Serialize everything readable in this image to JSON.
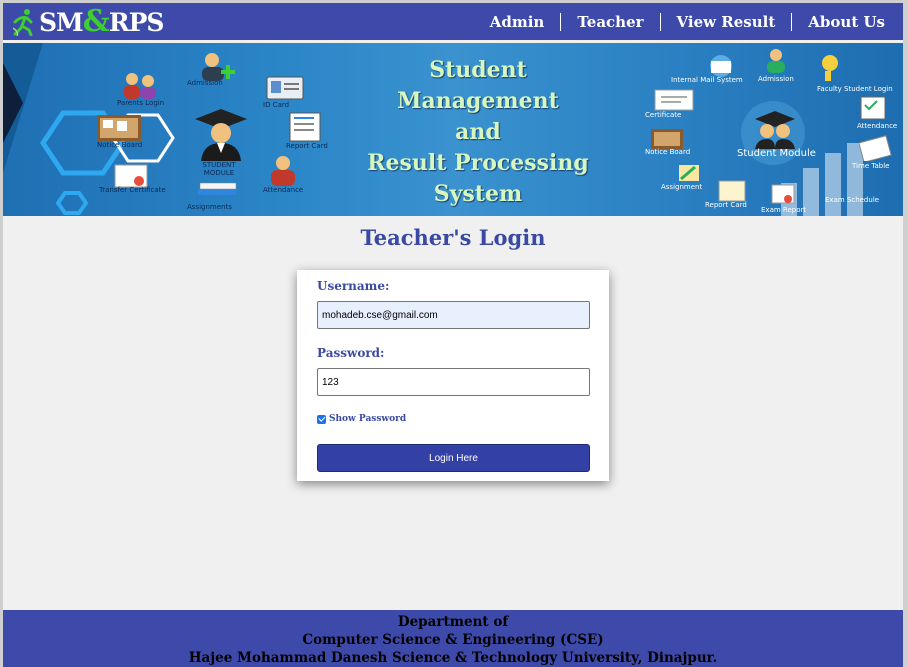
{
  "nav": {
    "logo": {
      "part1": "SM",
      "amp": "&",
      "part2": "RPS"
    },
    "links": [
      "Admin",
      "Teacher",
      "View Result",
      "About Us"
    ]
  },
  "banner": {
    "title_lines": [
      "Student",
      "Management",
      "and",
      "Result Processing",
      "System"
    ],
    "left_labels": [
      "Parents Login",
      "Admission",
      "ID Card",
      "Notice Board",
      "Report Card",
      "STUDENT MODULE",
      "Transfer Certificate",
      "Attendance",
      "Assignments"
    ],
    "right_labels": [
      "Internal Mail System",
      "Admission",
      "Faculty Student Login",
      "Certificate",
      "Attendance",
      "Notice Board",
      "Student Module",
      "Time Table",
      "Assignment",
      "Report Card",
      "Exam Report",
      "Exam Schedule"
    ]
  },
  "main": {
    "title": "Teacher's Login",
    "username_label": "Username:",
    "username_value": "mohadeb.cse@gmail.com",
    "password_label": "Password:",
    "password_value": "123",
    "show_password_label": "Show Password",
    "show_password_checked": true,
    "login_button": "Login Here"
  },
  "footer": {
    "lines": [
      "Department of",
      "Computer Science & Engineering (CSE)",
      "Hajee Mohammad Danesh Science & Technology University, Dinajpur."
    ]
  },
  "colors": {
    "nav_bg": "#3e4aa9",
    "accent": "#3a4aa3",
    "button": "#3340a6",
    "logo_amp": "#3ccf2f",
    "autofill": "#e8f0fe"
  }
}
